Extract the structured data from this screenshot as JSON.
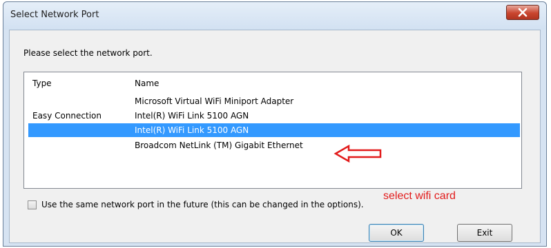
{
  "window": {
    "title": "Select Network Port"
  },
  "instruction": "Please select the network port.",
  "list": {
    "headers": {
      "type": "Type",
      "name": "Name"
    },
    "rows": [
      {
        "type": "",
        "name": "Microsoft Virtual WiFi Miniport Adapter",
        "selected": false
      },
      {
        "type": "Easy Connection",
        "name": "Intel(R) WiFi Link 5100 AGN",
        "selected": false
      },
      {
        "type": "",
        "name": "Intel(R) WiFi Link 5100 AGN",
        "selected": true
      },
      {
        "type": "",
        "name": "Broadcom NetLink (TM) Gigabit Ethernet",
        "selected": false
      }
    ]
  },
  "annotation": {
    "text": "select wifi card",
    "color": "#e21b1b"
  },
  "checkbox": {
    "label": "Use the same network port in the future (this can be changed in the options).",
    "checked": false
  },
  "buttons": {
    "ok": "OK",
    "exit": "Exit"
  },
  "colors": {
    "selection": "#3399ff",
    "close_button": "#c9462f"
  },
  "icons": {
    "close": "close-x-icon",
    "annotation": "arrow-left-icon"
  }
}
